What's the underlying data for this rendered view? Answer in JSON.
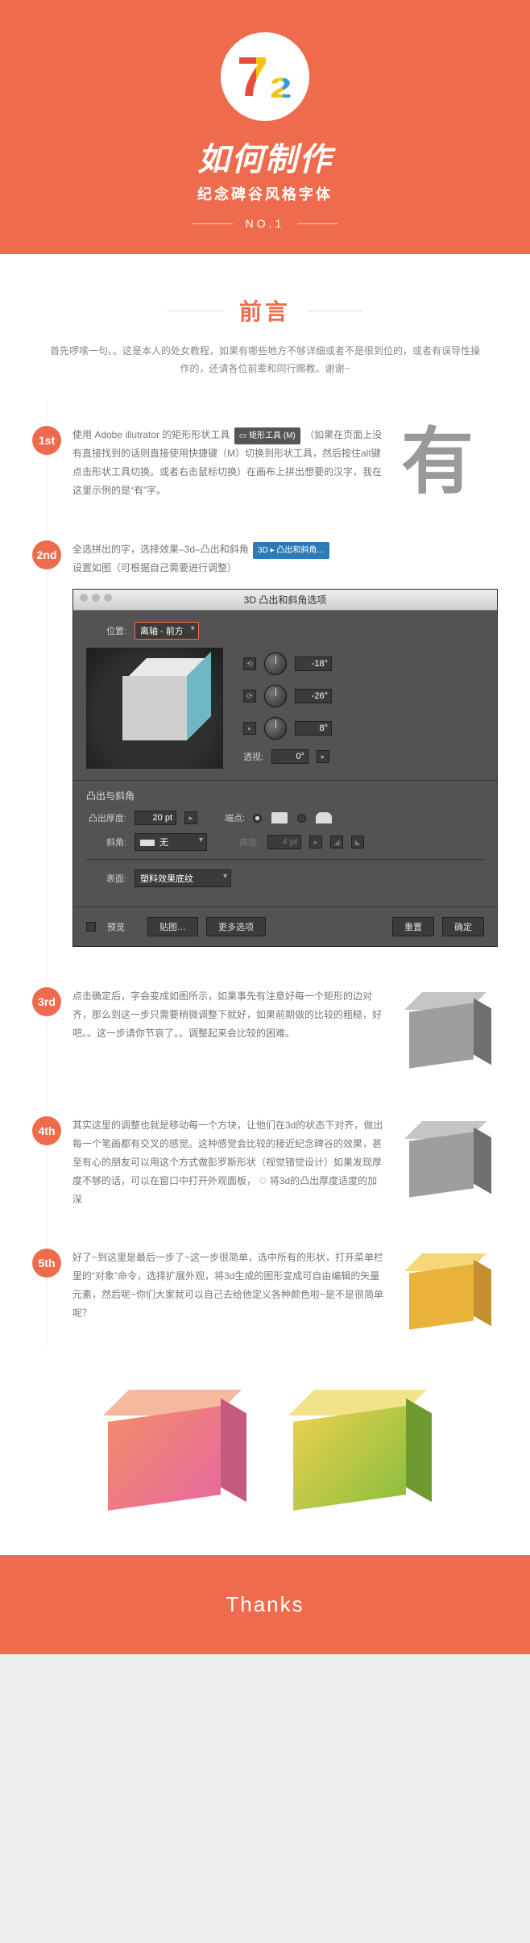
{
  "hero": {
    "logo_mark": "7₂",
    "title": "如何制作",
    "subtitle": "纪念碑谷风格字体",
    "issue": "NO.1"
  },
  "preface": {
    "heading": "前言",
    "body": "首先啰嗦一句。。这是本人的处女教程，如果有哪些地方不够详细或者不是很到位的，或者有误导性操作的，还请各位前辈和同行赐教。谢谢~"
  },
  "steps": [
    {
      "n": "1st",
      "text": "使用 Adobe illutrator 的矩形形状工具",
      "chip": "▭ 矩形工具 (M)",
      "tail": "（如果在页面上没有直接找到的话则直接使用快捷键（M）切换到形状工具，然后按住alt键点击形状工具切换。或者右击鼠标切换）在画布上拼出想要的汉字，我在这里示例的是“有”字。",
      "thumb_char": "有"
    },
    {
      "n": "2nd",
      "text": "全选拼出的字，选择效果–3d–凸出和斜角",
      "chip": "3D ▸ 凸出和斜角…",
      "tail": "设置如图（可根据自己需要进行调整）"
    },
    {
      "n": "3rd",
      "text": "点击确定后，字会变成如图所示，如果事先有注意好每一个矩形的边对齐，那么到这一步只需要稍微调整下就好，如果前期做的比较的粗糙，好吧。。这一步请你节哀了。。调整起来会比较的困难。"
    },
    {
      "n": "4th",
      "text": "其实这里的调整也就是移动每一个方块，让他们在3d的状态下对齐，做出每一个笔画都有交叉的感觉。这种感觉会比较的接近纪念碑谷的效果，甚至有心的朋友可以用这个方式做彭罗斯形状（视觉错觉设计）如果发现厚度不够的话，可以在窗口中打开外观面板，",
      "star": "✪",
      "tail": " 将3d的凸出厚度适度的加深"
    },
    {
      "n": "5th",
      "text": "好了~到这里是最后一步了~这一步很简单，选中所有的形状，打开菜单栏里的“对象”命令，选择扩展外观，将3d生成的图形变成可自由编辑的矢量元素，然后呢~你们大家就可以自己去给他定义各种颜色啦~是不是很简单呢？"
    }
  ],
  "dialog": {
    "title": "3D 凸出和斜角选项",
    "position_label": "位置:",
    "position_value": "离轴 - 前方",
    "rot_x": "-18°",
    "rot_y": "-26°",
    "rot_z": "8°",
    "perspective_label": "透视:",
    "perspective_value": "0°",
    "section_extrude": "凸出与斜角",
    "depth_label": "凸出厚度:",
    "depth_value": "20 pt",
    "cap_label": "端点:",
    "bevel_label": "斜角:",
    "bevel_value": "无",
    "height_label": "高度:",
    "height_value": "4 pt",
    "surface_label": "表面:",
    "surface_value": "塑料效果底纹",
    "preview": "预览",
    "map": "贴图…",
    "more": "更多选项",
    "reset": "重置",
    "ok": "确定"
  },
  "footer": {
    "thanks": "Thanks"
  }
}
